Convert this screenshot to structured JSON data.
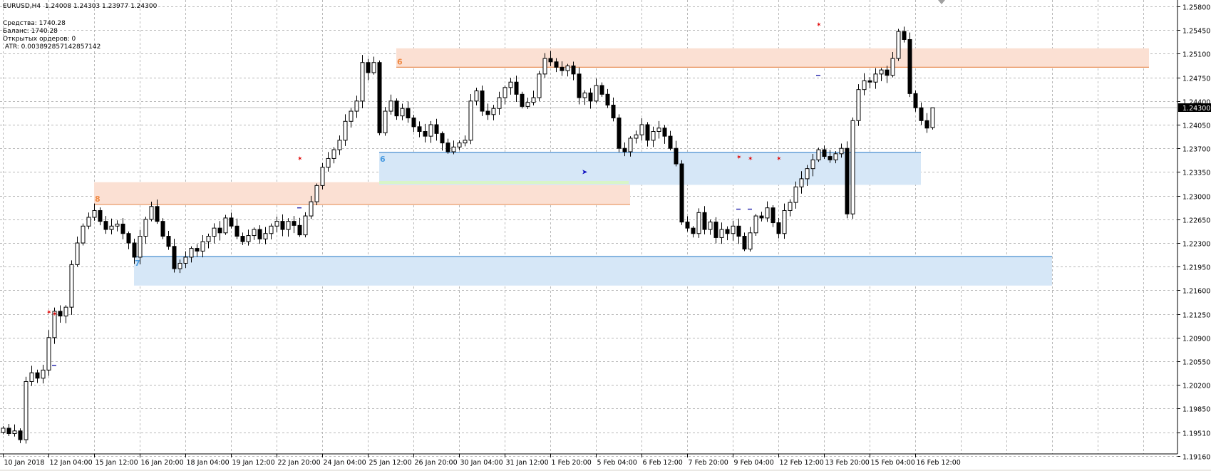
{
  "header": {
    "symbol": "EURUSD,H4",
    "ohlc_text": "1.24008 1.24303 1.23977 1.24300"
  },
  "account": {
    "equity": "Средства: 1740.28",
    "balance": "Баланс: 1740.28",
    "open_orders": "Открытых ордеров: 0",
    "atr": " ATR: 0.003892857142857142"
  },
  "colors": {
    "supply_zone": "#fbe0d3",
    "supply_line": "#e8915a",
    "supply_label": "#f08a45",
    "demand_zone": "#d6e7f7",
    "demand_line": "#4a8fd0",
    "demand_label": "#4a9be0",
    "green_line": "#d8f5c8",
    "grid": "#b8b8b8"
  },
  "chart_data": {
    "type": "candlestick",
    "symbol": "EURUSD",
    "timeframe": "H4",
    "ylim": [
      1.1915,
      1.2587
    ],
    "current_price": "1.24300",
    "last_candle": {
      "open": 1.24008,
      "high": 1.24303,
      "low": 1.23977,
      "close": 1.243
    },
    "first_open": 1.195,
    "close": [
      1.1956,
      1.1948,
      1.1952,
      1.1939,
      1.2025,
      1.2038,
      1.203,
      1.2042,
      1.209,
      1.2129,
      1.2122,
      1.2135,
      1.2198,
      1.223,
      1.2255,
      1.2268,
      1.2278,
      1.2262,
      1.225,
      1.2255,
      1.2258,
      1.2244,
      1.223,
      1.2209,
      1.224,
      1.2265,
      1.2284,
      1.2262,
      1.224,
      1.2225,
      1.2192,
      1.22,
      1.2209,
      1.2222,
      1.2218,
      1.2232,
      1.224,
      1.2252,
      1.2245,
      1.2267,
      1.2255,
      1.224,
      1.2232,
      1.2241,
      1.225,
      1.2236,
      1.2244,
      1.2255,
      1.2262,
      1.225,
      1.2262,
      1.2256,
      1.2242,
      1.227,
      1.2291,
      1.2315,
      1.2342,
      1.2355,
      1.2368,
      1.2382,
      1.241,
      1.2425,
      1.244,
      1.2497,
      1.2482,
      1.2497,
      1.2393,
      1.2425,
      1.244,
      1.2418,
      1.2429,
      1.2415,
      1.2402,
      1.2395,
      1.2388,
      1.2405,
      1.2392,
      1.2378,
      1.2365,
      1.2372,
      1.2378,
      1.2382,
      1.244,
      1.2455,
      1.2425,
      1.242,
      1.2429,
      1.2445,
      1.246,
      1.2468,
      1.245,
      1.2432,
      1.2438,
      1.2445,
      1.248,
      1.2503,
      1.2498,
      1.249,
      1.2485,
      1.2492,
      1.248,
      1.2445,
      1.2452,
      1.244,
      1.2463,
      1.245,
      1.2434,
      1.2415,
      1.237,
      1.2365,
      1.2385,
      1.239,
      1.2405,
      1.2382,
      1.2395,
      1.24,
      1.2388,
      1.237,
      1.2347,
      1.2261,
      1.2252,
      1.2244,
      1.2275,
      1.225,
      1.2261,
      1.2238,
      1.225,
      1.2244,
      1.2255,
      1.224,
      1.2221,
      1.2245,
      1.227,
      1.2267,
      1.2282,
      1.226,
      1.2244,
      1.2278,
      1.229,
      1.2313,
      1.2325,
      1.234,
      1.2353,
      1.2368,
      1.2358,
      1.2353,
      1.2362,
      1.237,
      1.2273,
      1.2411,
      1.2457,
      1.247,
      1.2468,
      1.248,
      1.2486,
      1.2478,
      1.2503,
      1.2543,
      1.2531,
      1.2451,
      1.243,
      1.2411,
      1.24,
      1.243
    ],
    "price_labels": [
      "1.25800",
      "1.25450",
      "1.25100",
      "1.24750",
      "1.24400",
      "1.24050",
      "1.23700",
      "1.23350",
      "1.23000",
      "1.22650",
      "1.22300",
      "1.21950",
      "1.21600",
      "1.21250",
      "1.20900",
      "1.20550",
      "1.20200",
      "1.19850",
      "1.19510",
      "1.19160"
    ],
    "time_labels": [
      "10 Jan 2018",
      "12 Jan 04:00",
      "15 Jan 12:00",
      "16 Jan 20:00",
      "18 Jan 04:00",
      "19 Jan 12:00",
      "22 Jan 20:00",
      "24 Jan 04:00",
      "25 Jan 12:00",
      "26 Jan 20:00",
      "30 Jan 04:00",
      "31 Jan 12:00",
      "1 Feb 20:00",
      "5 Feb 04:00",
      "6 Feb 12:00",
      "7 Feb 20:00",
      "9 Feb 04:00",
      "12 Feb 12:00",
      "13 Feb 20:00",
      "15 Feb 04:00",
      "16 Feb 12:00"
    ],
    "zones": [
      {
        "kind": "supply",
        "label": "8",
        "from_bar": 16,
        "to_bar": 110,
        "top": 1.232,
        "bottom": 1.2287
      },
      {
        "kind": "demand",
        "label": "7",
        "from_bar": 23,
        "to_bar": 184,
        "top": 1.221,
        "bottom": 1.2167
      },
      {
        "kind": "supply",
        "label": "6",
        "from_bar": 69,
        "to_bar": 201,
        "top": 1.2518,
        "bottom": 1.249
      },
      {
        "kind": "demand",
        "label": "6",
        "from_bar": 66,
        "to_bar": 161,
        "top": 1.2364,
        "bottom": 1.2316
      }
    ],
    "signals": [
      {
        "bar": 8,
        "price": 1.2128,
        "type": "sell"
      },
      {
        "bar": 9,
        "price": 1.2125,
        "type": "sell"
      },
      {
        "bar": 9,
        "price": 1.2049,
        "type": "dash"
      },
      {
        "bar": 52,
        "price": 1.2355,
        "type": "sell"
      },
      {
        "bar": 52,
        "price": 1.2282,
        "type": "dash"
      },
      {
        "bar": 102,
        "price": 1.2335,
        "type": "buy"
      },
      {
        "bar": 129,
        "price": 1.2357,
        "type": "sell"
      },
      {
        "bar": 131,
        "price": 1.2355,
        "type": "sell"
      },
      {
        "bar": 136,
        "price": 1.2355,
        "type": "sell"
      },
      {
        "bar": 129,
        "price": 1.228,
        "type": "dash"
      },
      {
        "bar": 131,
        "price": 1.228,
        "type": "dash"
      },
      {
        "bar": 143,
        "price": 1.2553,
        "type": "sell"
      },
      {
        "bar": 143,
        "price": 1.2478,
        "type": "dash"
      }
    ]
  }
}
